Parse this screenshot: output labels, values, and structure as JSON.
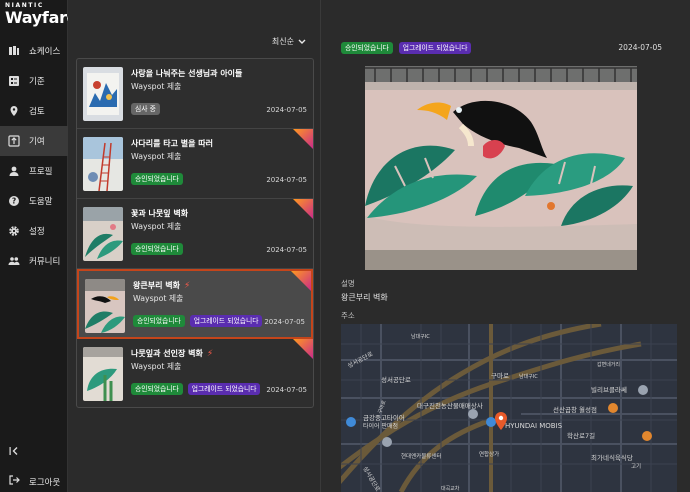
{
  "brand": {
    "company": "NIANTIC",
    "product": "Wayfarer"
  },
  "sidebar": {
    "items": [
      {
        "label": "쇼케이스",
        "icon": "showcase-icon"
      },
      {
        "label": "기준",
        "icon": "criteria-icon"
      },
      {
        "label": "검토",
        "icon": "review-pin-icon"
      },
      {
        "label": "기여",
        "icon": "contribute-icon"
      },
      {
        "label": "프로필",
        "icon": "profile-icon"
      },
      {
        "label": "도움말",
        "icon": "help-icon"
      },
      {
        "label": "설정",
        "icon": "gear-icon"
      },
      {
        "label": "커뮤니티",
        "icon": "community-icon"
      }
    ],
    "collapse_icon": "collapse-left-icon",
    "logout_label": "로그아웃"
  },
  "list": {
    "sort_label": "최신순",
    "items": [
      {
        "title": "사랑을 나눠주는 선생님과 아이들",
        "subtitle": "Wayspot 제출",
        "badges": [
          {
            "text": "심사 중",
            "kind": "gray"
          }
        ],
        "date": "2024-07-05",
        "upgraded": false,
        "bolt": false
      },
      {
        "title": "사다리를 타고 별을 따러",
        "subtitle": "Wayspot 제출",
        "badges": [
          {
            "text": "승인되었습니다",
            "kind": "green"
          }
        ],
        "date": "2024-07-05",
        "upgraded": false,
        "bolt": false
      },
      {
        "title": "꽃과 나뭇잎 벽화",
        "subtitle": "Wayspot 제출",
        "badges": [
          {
            "text": "승인되었습니다",
            "kind": "green"
          }
        ],
        "date": "2024-07-05",
        "upgraded": false,
        "bolt": false
      },
      {
        "title": "왕큰부리 벽화",
        "subtitle": "Wayspot 제출",
        "badges": [
          {
            "text": "승인되었습니다",
            "kind": "green"
          },
          {
            "text": "업그레이드 되었습니다",
            "kind": "purple"
          }
        ],
        "date": "2024-07-05",
        "upgraded": true,
        "bolt": true
      },
      {
        "title": "나뭇잎과 선인장 벽화",
        "subtitle": "Wayspot 제출",
        "badges": [
          {
            "text": "승인되었습니다",
            "kind": "green"
          },
          {
            "text": "업그레이드 되었습니다",
            "kind": "purple"
          }
        ],
        "date": "2024-07-05",
        "upgraded": true,
        "bolt": true
      }
    ]
  },
  "detail": {
    "status": "승인되었습니다",
    "upgrade": "업그레이드 되었습니다",
    "date": "2024-07-05",
    "desc_label": "설명",
    "desc_value": "왕큰부리 벽화",
    "addr_label": "주소",
    "map_labels": {
      "a": "남대구IC",
      "b": "성서공단로",
      "c": "구마로",
      "d": "남대구IC",
      "e": "갑변네거리",
      "f": "빌리브클라쎄",
      "g": "대구진천농산물매매상사",
      "h": "선산곱창 월성점",
      "i": "금강중고타이어",
      "j": "타이어 판매점",
      "k": "HYUNDAI MOBIS",
      "l": "학산로7길",
      "m": "최가네식육식당",
      "n": "고기",
      "o": "구마로",
      "p": "성서공단로",
      "q": "현대엔카물류센터",
      "r": "연합상가",
      "s": "대곡교차"
    }
  }
}
